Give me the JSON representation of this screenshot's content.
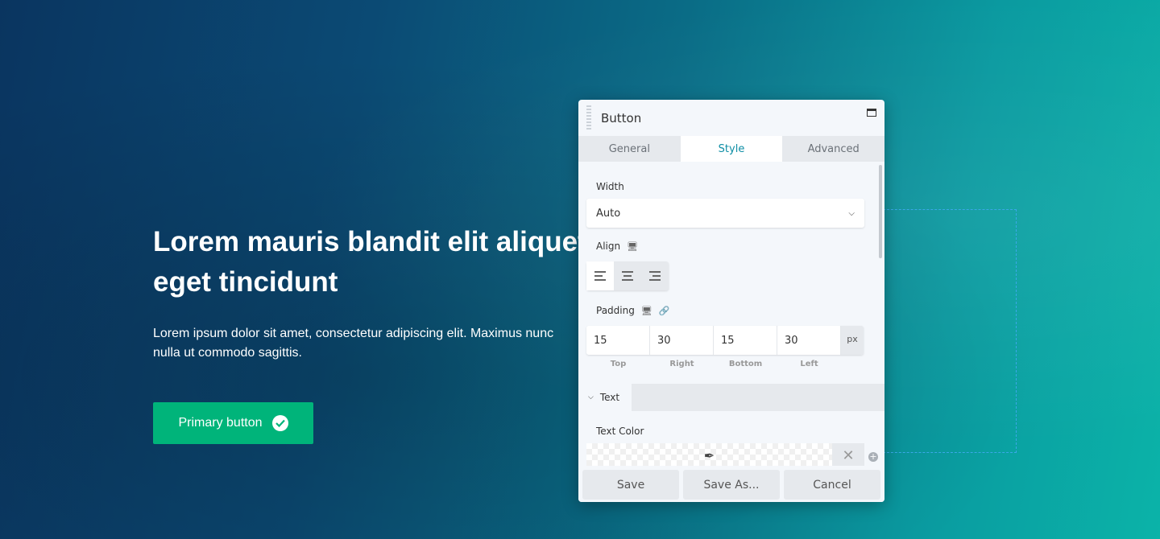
{
  "hero": {
    "title": "Lorem mauris blandit elit aliquet eget tincidunt",
    "text_line1": "Lorem ipsum dolor sit amet, consectetur adipiscing elit. Maximus nunc",
    "text_line2": "nulla ut commodo sagittis.",
    "button_label": "Primary button"
  },
  "colors": {
    "accent": "#0e8ea5",
    "primary_button": "#00b47a",
    "selection": "#3aa8e8"
  },
  "panel": {
    "title": "Button",
    "tabs": [
      {
        "label": "General"
      },
      {
        "label": "Style"
      },
      {
        "label": "Advanced"
      }
    ],
    "active_tab": "Style",
    "width": {
      "label": "Width",
      "value": "Auto"
    },
    "align": {
      "label": "Align",
      "options": [
        "left",
        "center",
        "right"
      ],
      "selected": "left"
    },
    "padding": {
      "label": "Padding",
      "unit": "px",
      "fields": [
        {
          "label": "Top",
          "value": "15"
        },
        {
          "label": "Right",
          "value": "30"
        },
        {
          "label": "Bottom",
          "value": "15"
        },
        {
          "label": "Left",
          "value": "30"
        }
      ]
    },
    "text_section": {
      "label": "Text",
      "text_color_label": "Text Color"
    },
    "footer": {
      "save": "Save",
      "save_as": "Save As...",
      "cancel": "Cancel"
    }
  }
}
